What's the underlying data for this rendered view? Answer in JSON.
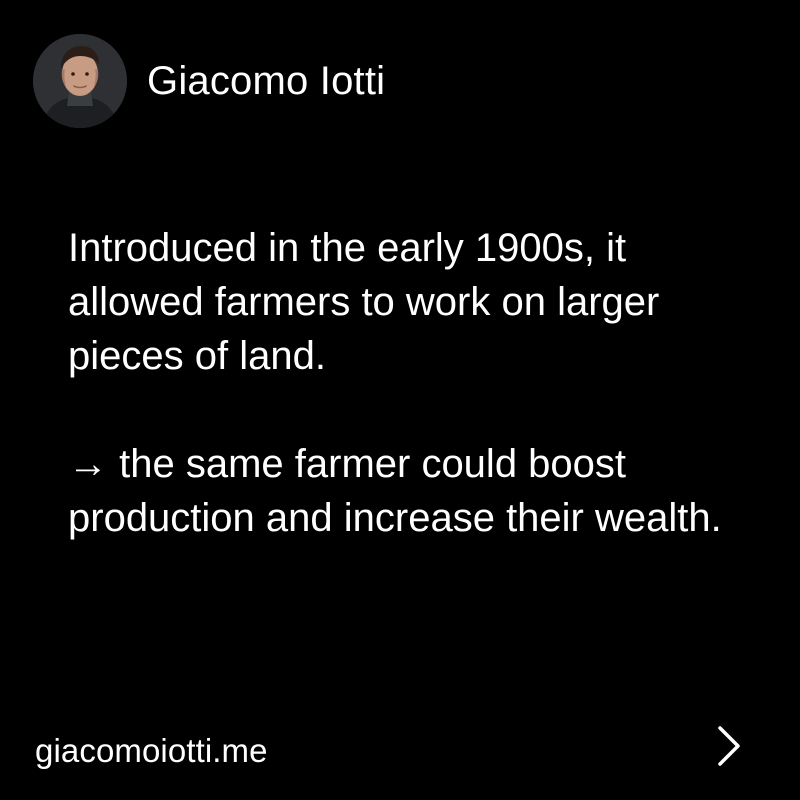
{
  "author": {
    "name": "Giacomo Iotti",
    "avatar_icon": "profile-photo"
  },
  "post": {
    "paragraphs": [
      "Introduced in the early 1900s, it allowed farmers to work on larger pieces of land.",
      "→ the same farmer could boost production and increase their wealth."
    ]
  },
  "footer": {
    "website": "giacomoiotti.me",
    "next_icon": "chevron-right-icon"
  },
  "colors": {
    "background": "#000000",
    "text": "#ffffff"
  }
}
